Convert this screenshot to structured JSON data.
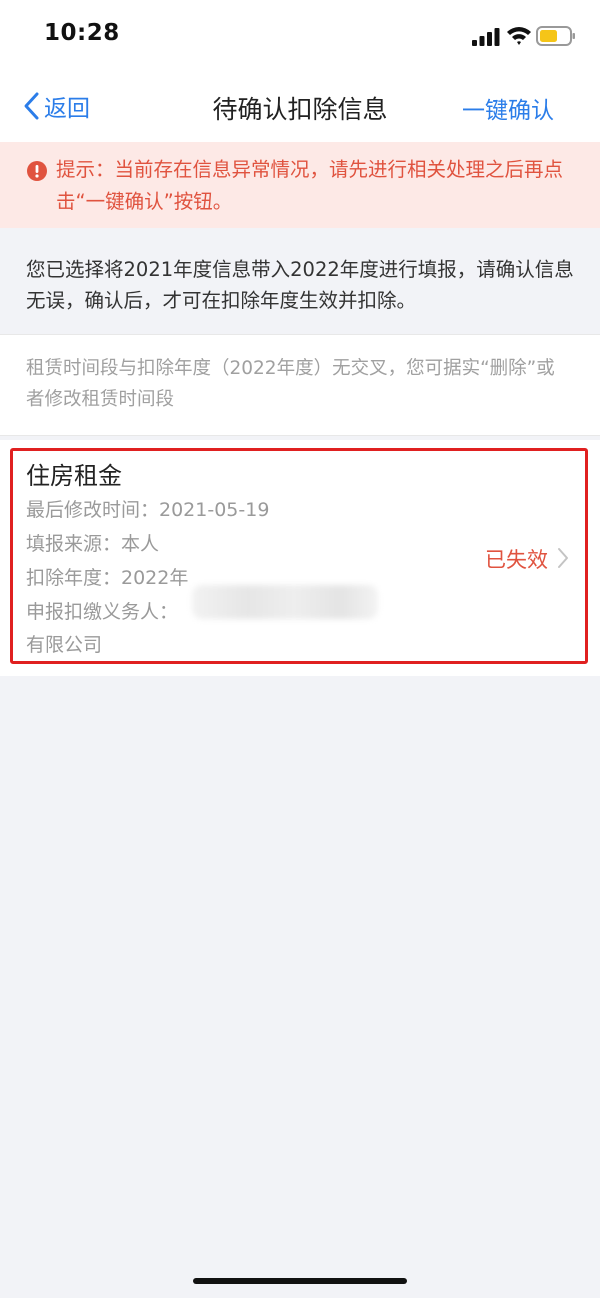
{
  "status_bar": {
    "time": "10:28"
  },
  "nav": {
    "back_label": "返回",
    "title": "待确认扣除信息",
    "confirm_all_label": "一键确认"
  },
  "alert": {
    "text": "提示：当前存在信息异常情况，请先进行相关处理之后再点击“一键确认”按钮。"
  },
  "intro": {
    "text": "您已选择将2021年度信息带入2022年度进行填报，请确认信息无误，确认后，才可在扣除年度生效并扣除。"
  },
  "note": {
    "text": "租赁时间段与扣除年度（2022年度）无交叉，您可据实“删除”或者修改租赁时间段"
  },
  "card": {
    "title": "住房租金",
    "modified": "最后修改时间：2021-05-19",
    "source": "填报来源：本人",
    "year": "扣除年度：2022年",
    "withholder_label": "申报扣缴义务人：",
    "company_suffix": "有限公司",
    "status": "已失效"
  },
  "colors": {
    "accent_blue": "#2b7de9",
    "alert_red": "#e0533f",
    "highlight_red": "#e02020",
    "alert_bg": "#fde9e6",
    "page_bg": "#f2f3f7"
  }
}
